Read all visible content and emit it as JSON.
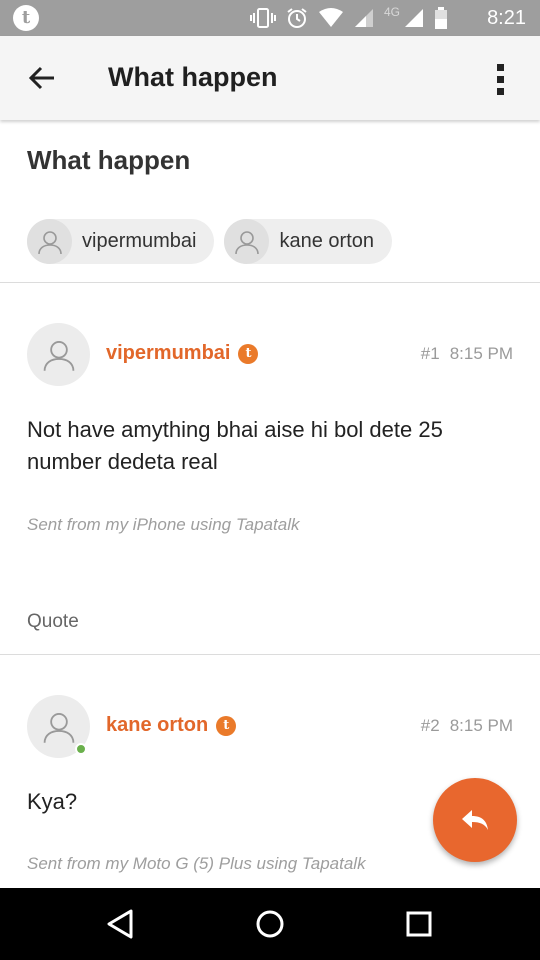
{
  "status_bar": {
    "app_icon_letter": "t",
    "network": "4G",
    "time": "8:21"
  },
  "app_bar": {
    "title": "What happen",
    "back_icon": "arrow-back-icon",
    "menu_icon": "more-vert-icon"
  },
  "thread": {
    "title": "What happen",
    "participants": [
      "vipermumbai",
      "kane orton"
    ]
  },
  "posts": [
    {
      "author": "vipermumbai",
      "badge": "t",
      "number": "#1",
      "time": "8:15 PM",
      "body": "Not have amything bhai aise hi bol dete 25 number dedeta real",
      "signature": "Sent from my iPhone using Tapatalk",
      "quote_label": "Quote",
      "online": false
    },
    {
      "author": "kane orton",
      "badge": "t",
      "number": "#2",
      "time": "8:15 PM",
      "body": "Kya?",
      "signature": "Sent from my Moto G (5) Plus using Tapatalk",
      "online": true
    }
  ],
  "fab": {
    "icon": "reply-icon",
    "color": "#e8672e"
  },
  "colors": {
    "accent": "#e2672a",
    "online": "#6ab04c",
    "status_bar": "#9e9e9e"
  }
}
